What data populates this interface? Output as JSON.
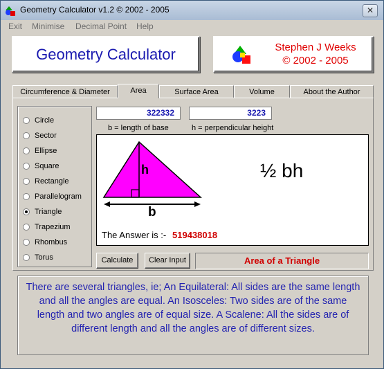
{
  "window": {
    "title": "Geometry Calculator v1.2 ©  2002 - 2005",
    "close_glyph": "✕"
  },
  "menu": [
    "Exit",
    "Minimise",
    "Decimal Point",
    "Help"
  ],
  "header": {
    "app_name": "Geometry Calculator",
    "author_line1": "Stephen J Weeks",
    "author_line2": "© 2002 - 2005"
  },
  "tabs": [
    "Circumference & Diameter",
    "Area",
    "Surface Area",
    "Volume",
    "About the Author"
  ],
  "active_tab": "Area",
  "shapes": [
    "Circle",
    "Sector",
    "Ellipse",
    "Square",
    "Rectangle",
    "Parallelogram",
    "Triangle",
    "Trapezium",
    "Rhombus",
    "Torus"
  ],
  "selected_shape": "Triangle",
  "inputs": {
    "base_value": "322332",
    "height_value": "3223",
    "base_caption": "b = length of base",
    "height_caption": "h = perpendicular height"
  },
  "diagram": {
    "height_label": "h",
    "base_label": "b",
    "formula": "½ bh",
    "answer_prefix": "The Answer is :-",
    "answer_value": "519438018",
    "fill_color": "#ff00ff"
  },
  "buttons": {
    "calculate": "Calculate",
    "clear": "Clear Input"
  },
  "area_title": "Area of a Triangle",
  "description": "There are several triangles, ie; An Equilateral: All sides are the same length and all the angles are equal. An Isosceles: Two sides are of the same length and two angles are of equal size. A Scalene: All the sides are of different length and all the angles are of different sizes.",
  "colors": {
    "accent_blue": "#1a1ab0",
    "accent_red": "#d00000"
  }
}
